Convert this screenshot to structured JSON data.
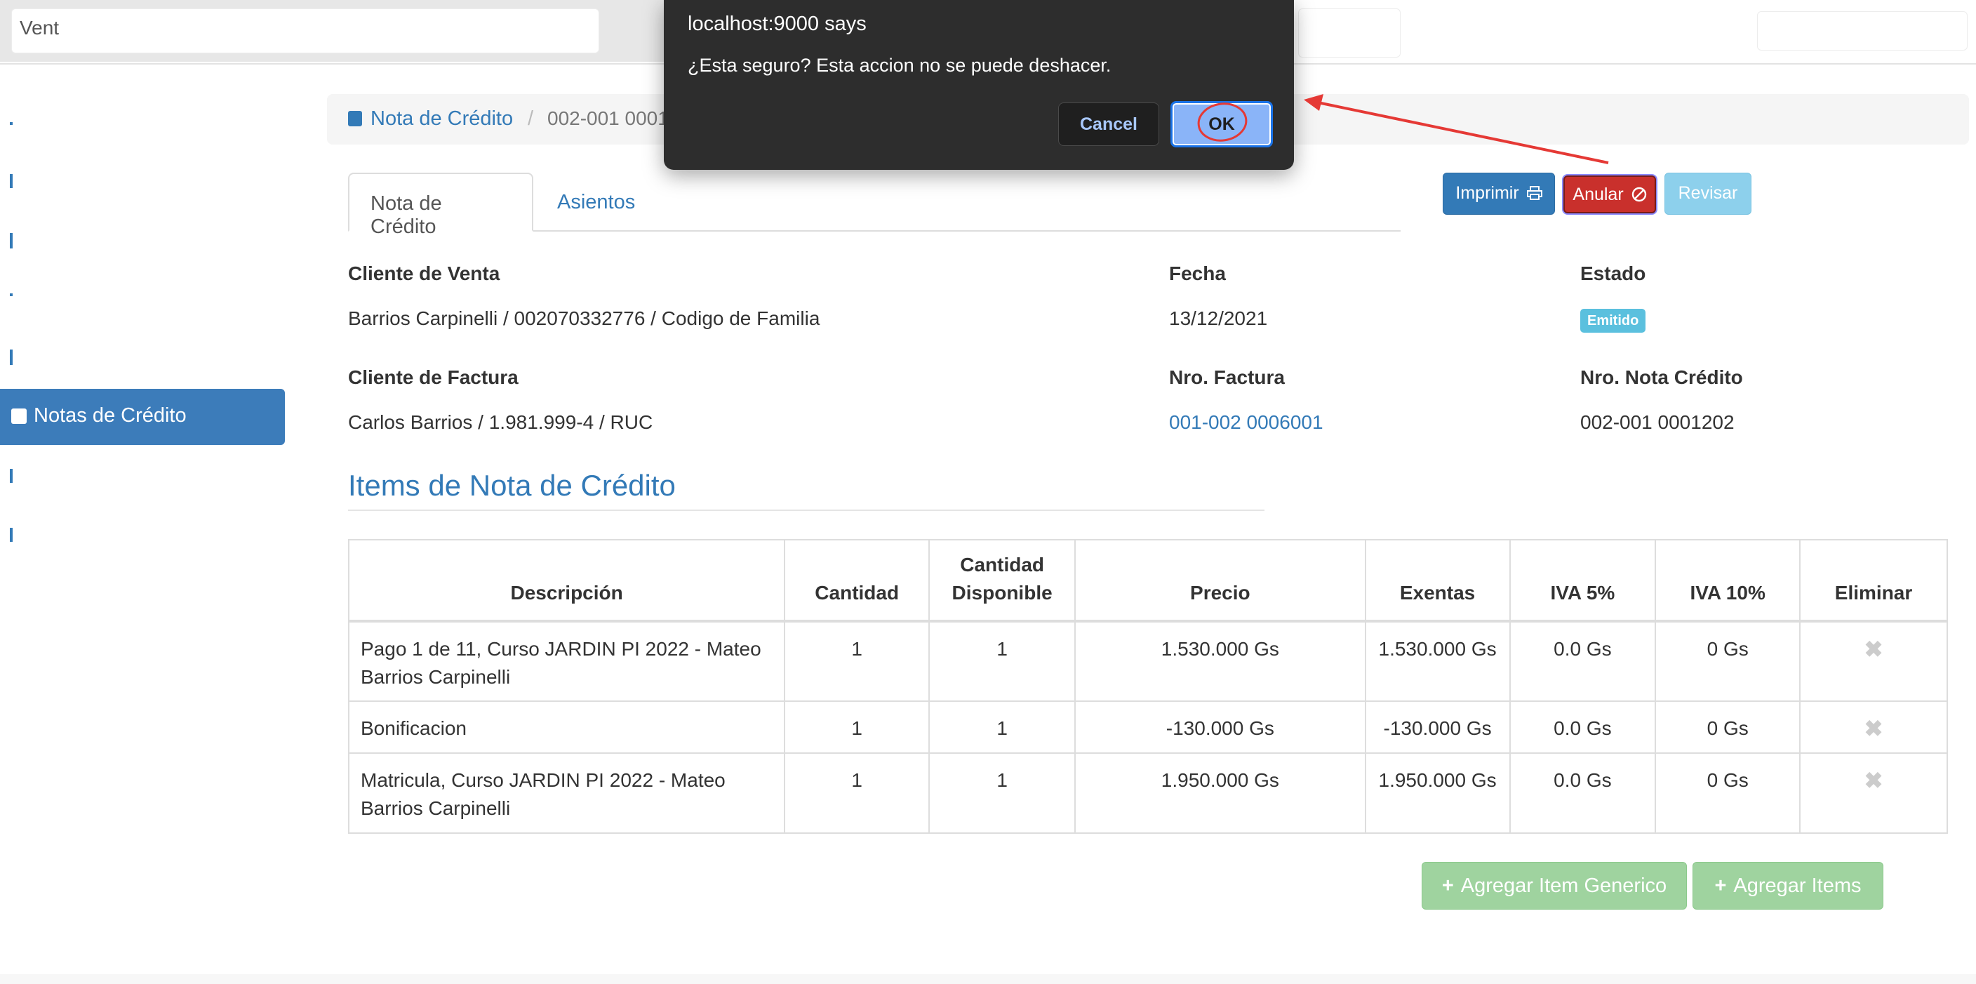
{
  "navbar": {
    "active_item": "Vent"
  },
  "sidebar": {
    "active_item": "Notas de Crédito"
  },
  "breadcrumb": {
    "link": "Nota de Crédito",
    "separator": "/",
    "current": "002-001 0001"
  },
  "tabs": [
    "Nota de Crédito",
    "Asientos"
  ],
  "actions": {
    "imprimir": "Imprimir",
    "anular": "Anular",
    "revisar": "Revisar"
  },
  "info": {
    "cliente_venta_label": "Cliente de Venta",
    "cliente_venta_value": "Barrios Carpinelli / 002070332776 / Codigo de Familia",
    "fecha_label": "Fecha",
    "fecha_value": "13/12/2021",
    "estado_label": "Estado",
    "estado_value": "Emitido",
    "cliente_factura_label": "Cliente de Factura",
    "cliente_factura_value": "Carlos Barrios / 1.981.999-4 / RUC",
    "nro_factura_label": "Nro. Factura",
    "nro_factura_value": "001-002 0006001",
    "nro_nota_label": "Nro. Nota Crédito",
    "nro_nota_value": "002-001 0001202"
  },
  "items_section": {
    "title": "Items de Nota de Crédito",
    "columns": [
      "Descripción",
      "Cantidad",
      "Cantidad Disponible",
      "Precio",
      "Exentas",
      "IVA 5%",
      "IVA 10%",
      "Eliminar"
    ],
    "rows": [
      {
        "descripcion": "Pago 1 de 11, Curso JARDIN PI 2022 - Mateo Barrios Carpinelli",
        "cantidad": "1",
        "disponible": "1",
        "precio": "1.530.000 Gs",
        "exentas": "1.530.000 Gs",
        "iva5": "0.0 Gs",
        "iva10": "0 Gs"
      },
      {
        "descripcion": "Bonificacion",
        "cantidad": "1",
        "disponible": "1",
        "precio": "-130.000 Gs",
        "exentas": "-130.000 Gs",
        "iva5": "0.0 Gs",
        "iva10": "0 Gs"
      },
      {
        "descripcion": "Matricula, Curso JARDIN PI 2022 - Mateo Barrios Carpinelli",
        "cantidad": "1",
        "disponible": "1",
        "precio": "1.950.000 Gs",
        "exentas": "1.950.000 Gs",
        "iva5": "0.0 Gs",
        "iva10": "0 Gs"
      }
    ],
    "delete_icon": "✖",
    "add_generic": "Agregar Item Generico",
    "add_items": "Agregar Items"
  },
  "dialog": {
    "title": "localhost:9000 says",
    "message": "¿Esta seguro? Esta accion no se puede deshacer.",
    "cancel": "Cancel",
    "ok": "OK"
  },
  "colors": {
    "primary": "#337ab7",
    "danger": "#c9302c",
    "info": "#5bc0de",
    "success_disabled": "#9fd39f",
    "dialog_bg": "#2d2d2d",
    "annotation_red": "#e53935"
  },
  "icons": {
    "breadcrumb": "sticky-note-icon",
    "imprimir": "print-icon",
    "anular": "ban-icon",
    "eliminar": "close-icon",
    "agregar": "plus-icon"
  }
}
